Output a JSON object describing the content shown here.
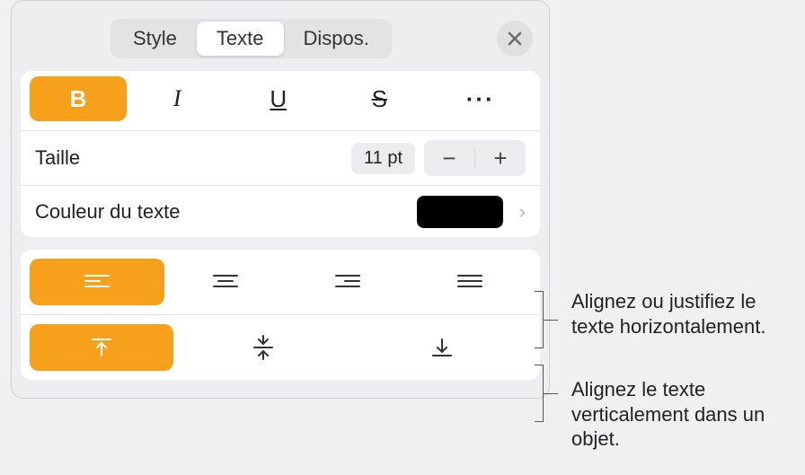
{
  "tabs": {
    "style": "Style",
    "texte": "Texte",
    "dispos": "Dispos."
  },
  "format": {
    "bold": "B",
    "italic": "I",
    "underline": "U",
    "strike": "S",
    "more": "···"
  },
  "size": {
    "label": "Taille",
    "value": "11 pt",
    "minus": "−",
    "plus": "+"
  },
  "color": {
    "label": "Couleur du texte",
    "chevron": "›",
    "value": "#000000"
  },
  "callouts": {
    "horiz": "Alignez ou justifiez le texte horizontalement.",
    "vert": "Alignez le texte verticalement dans un objet."
  }
}
